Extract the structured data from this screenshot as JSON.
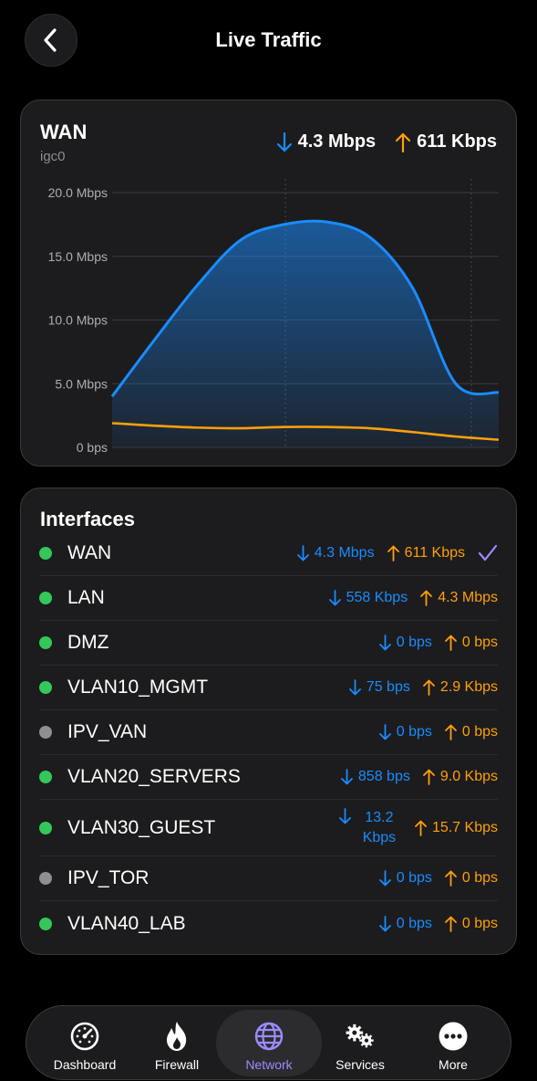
{
  "header": {
    "title": "Live Traffic"
  },
  "wan": {
    "title": "WAN",
    "subtitle": "igc0",
    "download": "4.3 Mbps",
    "upload": "611 Kbps"
  },
  "chart_data": {
    "type": "area",
    "ylabel": "",
    "xlabel": "",
    "ylim": [
      0,
      20
    ],
    "y_ticks": [
      "20.0 Mbps",
      "15.0 Mbps",
      "10.0 Mbps",
      "5.0 Mbps",
      "0 bps"
    ],
    "grid": true,
    "series": [
      {
        "name": "",
        "values": [
          4.0,
          8.5,
          12.8,
          16.3,
          17.5,
          17.7,
          16.5,
          12.5,
          5.0,
          4.3
        ],
        "color": "#1a8cff"
      },
      {
        "name": "",
        "values": [
          1.9,
          1.7,
          1.55,
          1.5,
          1.6,
          1.6,
          1.5,
          1.2,
          0.85,
          0.6
        ],
        "color": "#ff9f0a"
      }
    ]
  },
  "interfaces": {
    "title": "Interfaces",
    "items": [
      {
        "name": "WAN",
        "status": "on",
        "down": "4.3 Mbps",
        "up": "611 Kbps",
        "selected": true
      },
      {
        "name": "LAN",
        "status": "on",
        "down": "558 Kbps",
        "up": "4.3 Mbps"
      },
      {
        "name": "DMZ",
        "status": "on",
        "down": "0 bps",
        "up": "0 bps"
      },
      {
        "name": "VLAN10_MGMT",
        "status": "on",
        "down": "75 bps",
        "up": "2.9 Kbps"
      },
      {
        "name": "IPV_VAN",
        "status": "off",
        "down": "0 bps",
        "up": "0 bps"
      },
      {
        "name": "VLAN20_SERVERS",
        "status": "on",
        "down": "858 bps",
        "up": "9.0 Kbps"
      },
      {
        "name": "VLAN30_GUEST",
        "status": "on",
        "down": "13.2 Kbps",
        "up": "15.7 Kbps"
      },
      {
        "name": "IPV_TOR",
        "status": "off",
        "down": "0 bps",
        "up": "0 bps"
      },
      {
        "name": "VLAN40_LAB",
        "status": "on",
        "down": "0 bps",
        "up": "0 bps"
      }
    ]
  },
  "tabs": [
    {
      "label": "Dashboard",
      "icon": "gauge-icon"
    },
    {
      "label": "Firewall",
      "icon": "flame-icon"
    },
    {
      "label": "Network",
      "icon": "globe-icon",
      "active": true
    },
    {
      "label": "Services",
      "icon": "gears-icon"
    },
    {
      "label": "More",
      "icon": "more-icon"
    }
  ],
  "colors": {
    "download": "#1a8cff",
    "upload": "#ff9f0a",
    "accent": "#9a8cff",
    "online": "#34c759",
    "offline": "#8e8e93"
  }
}
